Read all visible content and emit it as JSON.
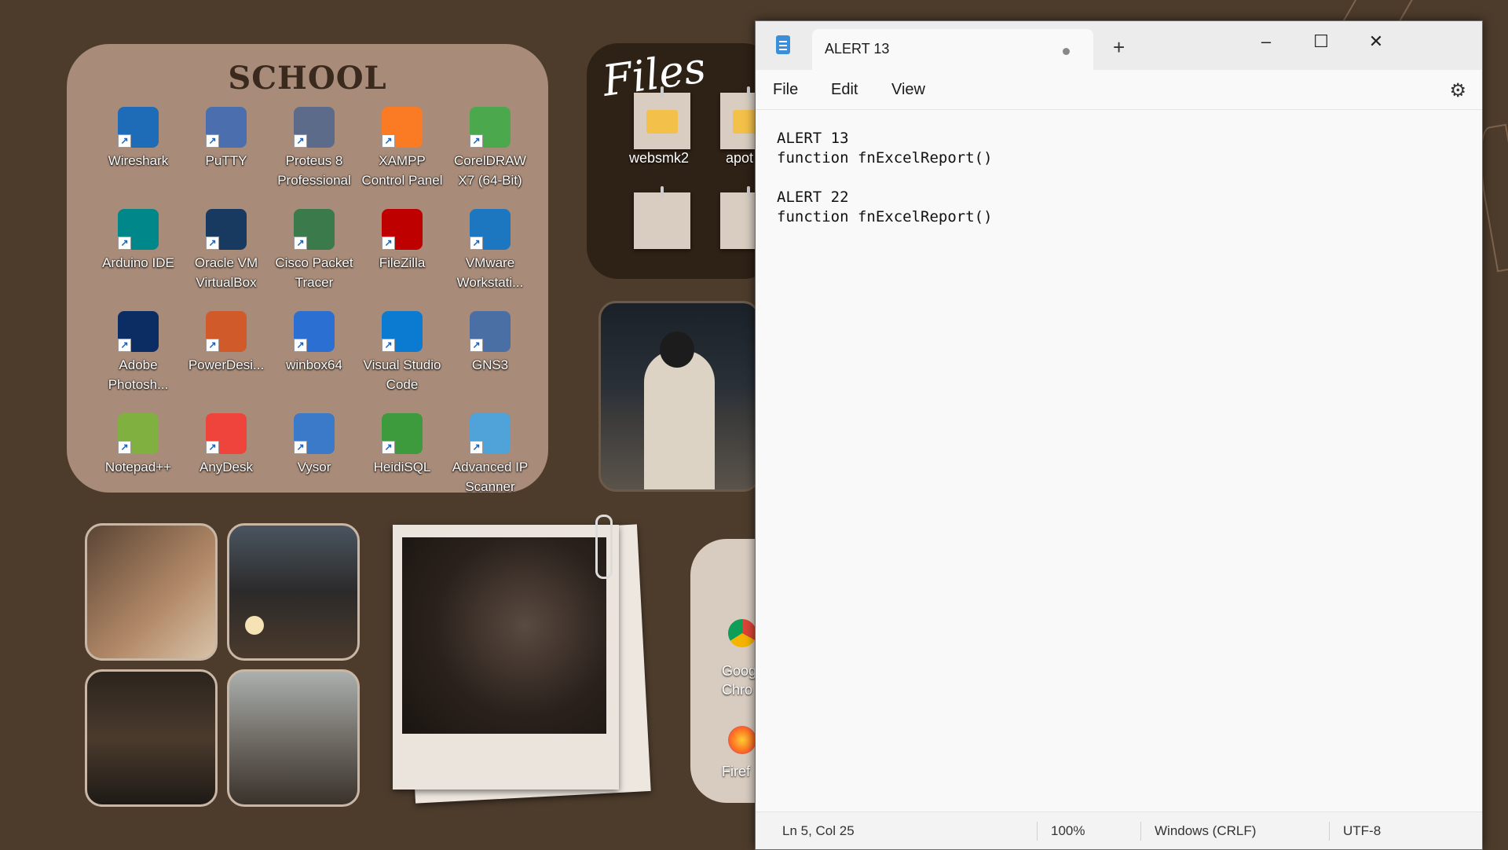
{
  "school": {
    "title": "SCHOOL",
    "apps": [
      {
        "label": "Wireshark",
        "icon": "wireshark-icon",
        "color": "#1e6bb8"
      },
      {
        "label": "PuTTY",
        "icon": "putty-icon",
        "color": "#4b6fae"
      },
      {
        "label": "Proteus 8 Professional",
        "icon": "proteus-icon",
        "color": "#5c6b8a"
      },
      {
        "label": "XAMPP Control Panel",
        "icon": "xampp-icon",
        "color": "#fb7a24"
      },
      {
        "label": "CorelDRAW X7 (64-Bit)",
        "icon": "coreldraw-icon",
        "color": "#4ca84c"
      },
      {
        "label": "Arduino IDE",
        "icon": "arduino-icon",
        "color": "#00878a"
      },
      {
        "label": "Oracle VM VirtualBox",
        "icon": "virtualbox-icon",
        "color": "#183a61"
      },
      {
        "label": "Cisco Packet Tracer",
        "icon": "packet-tracer-icon",
        "color": "#3b7a4a"
      },
      {
        "label": "FileZilla",
        "icon": "filezilla-icon",
        "color": "#bf0000"
      },
      {
        "label": "VMware Workstati...",
        "icon": "vmware-icon",
        "color": "#1d77c0"
      },
      {
        "label": "Adobe Photosh...",
        "icon": "photoshop-icon",
        "color": "#0b2d63"
      },
      {
        "label": "PowerDesi...",
        "icon": "powerdesigner-icon",
        "color": "#d05a2a"
      },
      {
        "label": "winbox64",
        "icon": "winbox-icon",
        "color": "#2a6fd1"
      },
      {
        "label": "Visual Studio Code",
        "icon": "vscode-icon",
        "color": "#0a7bd0"
      },
      {
        "label": "GNS3",
        "icon": "gns3-icon",
        "color": "#4a6fa5"
      },
      {
        "label": "Notepad++",
        "icon": "notepadpp-icon",
        "color": "#80b040"
      },
      {
        "label": "AnyDesk",
        "icon": "anydesk-icon",
        "color": "#ef443b"
      },
      {
        "label": "Vysor",
        "icon": "vysor-icon",
        "color": "#3a7ac8"
      },
      {
        "label": "HeidiSQL",
        "icon": "heidisql-icon",
        "color": "#3d9a3d"
      },
      {
        "label": "Advanced IP Scanner",
        "icon": "ip-scanner-icon",
        "color": "#4fa3d9"
      }
    ]
  },
  "files": {
    "title": "Files",
    "folders": [
      "websmk2",
      "apot"
    ]
  },
  "apps_panel": {
    "labels": [
      "Goog",
      "Chro",
      "Firef"
    ]
  },
  "notepad": {
    "tab_title": "ALERT 13",
    "new_tab_symbol": "+",
    "window_buttons": {
      "minimize": "–",
      "maximize": "☐",
      "close": "✕"
    },
    "menu": [
      "File",
      "Edit",
      "View"
    ],
    "content_lines": [
      "ALERT 13",
      "function fnExcelReport()",
      "",
      "ALERT 22",
      "function fnExcelReport()"
    ],
    "status": {
      "position": "Ln 5, Col 25",
      "zoom": "100%",
      "line_ending": "Windows (CRLF)",
      "encoding": "UTF-8"
    }
  }
}
